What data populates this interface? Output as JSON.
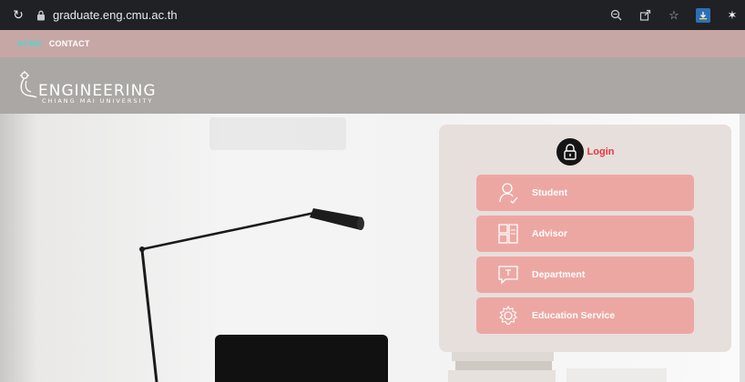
{
  "browser": {
    "url": "graduate.eng.cmu.ac.th"
  },
  "nav": {
    "home_label": "HOME",
    "contact_label": "CONTACT",
    "home_color": "#5fd1c7"
  },
  "header": {
    "logo_line1": "ENGINEERING",
    "logo_line2": "CHIANG MAI UNIVERSITY"
  },
  "login": {
    "title": "Login",
    "title_color": "#e8373d",
    "roles": [
      {
        "label": "Student",
        "icon": "student-icon"
      },
      {
        "label": "Advisor",
        "icon": "advisor-icon"
      },
      {
        "label": "Department",
        "icon": "department-icon"
      },
      {
        "label": "Education Service",
        "icon": "education-service-icon"
      }
    ],
    "button_color": "#eda7a3"
  }
}
